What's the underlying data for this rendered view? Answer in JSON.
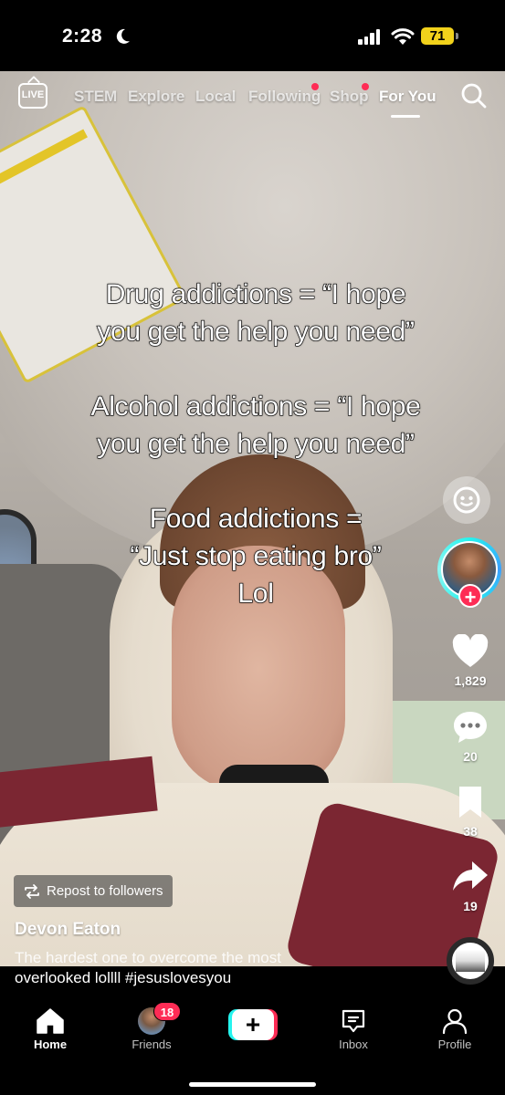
{
  "status_bar": {
    "time": "2:28",
    "battery": "71",
    "icons": [
      "moon-icon",
      "signal-icon",
      "wifi-icon",
      "battery-icon"
    ]
  },
  "top_nav": {
    "live_label": "LIVE",
    "tabs": [
      {
        "label": "STEM"
      },
      {
        "label": "Explore"
      },
      {
        "label": "Local"
      },
      {
        "label": "Following",
        "has_dot": true
      },
      {
        "label": "Shop",
        "has_dot": true
      },
      {
        "label": "For You",
        "active": true
      }
    ],
    "search_icon": "search-icon"
  },
  "overlay_text": {
    "lines": [
      "Drug addictions = “I hope",
      "you get the help you need”",
      "",
      "Alcohol addictions = “I hope",
      "you get the help you need”",
      "",
      "Food addictions =",
      "“Just stop eating bro”",
      "Lol"
    ]
  },
  "right_rail": {
    "likes": "1,829",
    "comments": "20",
    "saves": "38",
    "shares": "19"
  },
  "post": {
    "repost_label": "Repost to followers",
    "author": "Devon Eaton",
    "description_line1": "The hardest one to overcome the most",
    "description_line2": "overlooked lollll #jesuslovesyou"
  },
  "tab_bar": {
    "items": [
      {
        "label": "Home",
        "active": true
      },
      {
        "label": "Friends",
        "badge": "18"
      },
      {
        "label": "Inbox"
      },
      {
        "label": "Profile"
      }
    ],
    "create_symbol": "+"
  },
  "colors": {
    "accent_red": "#fe2c55",
    "accent_cyan": "#25f4ee",
    "battery_yellow": "#f2d21b"
  }
}
